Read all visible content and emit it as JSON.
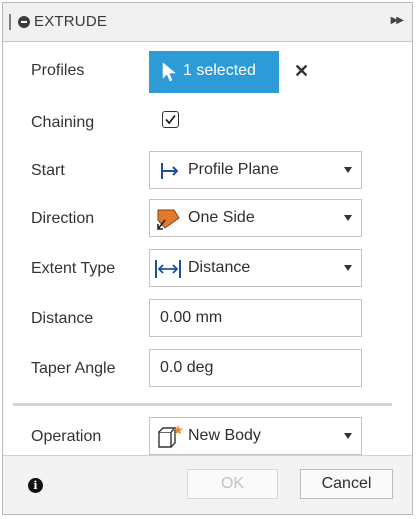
{
  "dialog": {
    "title": "EXTRUDE",
    "profiles": {
      "label": "Profiles",
      "button": "1 selected"
    },
    "chaining": {
      "label": "Chaining",
      "checked": true
    },
    "start": {
      "label": "Start",
      "value": "Profile Plane",
      "icon": "profile-plane-icon"
    },
    "direction": {
      "label": "Direction",
      "value": "One Side",
      "icon": "one-side-icon"
    },
    "extent_type": {
      "label": "Extent Type",
      "value": "Distance",
      "icon": "distance-icon"
    },
    "distance": {
      "label": "Distance",
      "value": "0.00 mm"
    },
    "taper_angle": {
      "label": "Taper Angle",
      "value": "0.0 deg"
    },
    "operation": {
      "label": "Operation",
      "value": "New Body",
      "icon": "new-body-icon"
    },
    "footer": {
      "ok": "OK",
      "cancel": "Cancel"
    }
  },
  "colors": {
    "accent": "#2d9bd7",
    "direction_icon": "#e07a2e",
    "new_body_star": "#f08a24"
  }
}
